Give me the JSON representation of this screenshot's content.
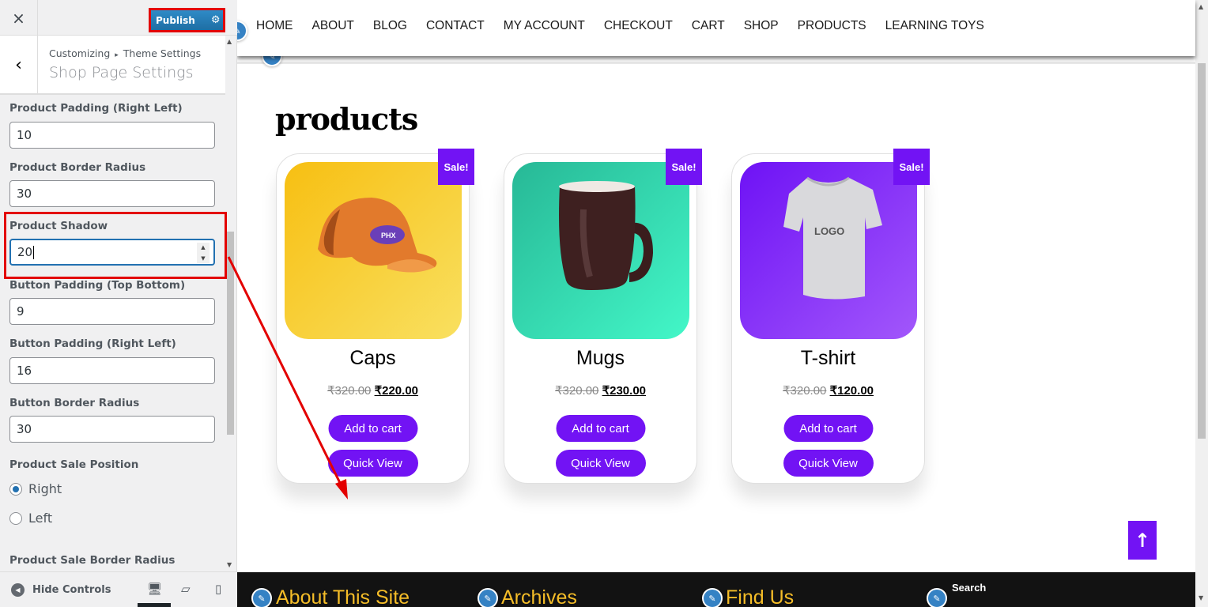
{
  "sidebar": {
    "close_icon": "×",
    "publish_label": "Publish",
    "breadcrumb_root": "Customizing",
    "breadcrumb_separator": "▸",
    "breadcrumb_parent": "Theme Settings",
    "section_title": "Shop Page Settings",
    "controls": [
      {
        "label": "Product Padding (Right Left)",
        "value": "10"
      },
      {
        "label": "Product Border Radius",
        "value": "30"
      },
      {
        "label": "Product Shadow",
        "value": "20"
      },
      {
        "label": "Button Padding (Top Bottom)",
        "value": "9"
      },
      {
        "label": "Button Padding (Right Left)",
        "value": "16"
      },
      {
        "label": "Button Border Radius",
        "value": "30"
      }
    ],
    "sale_position": {
      "label": "Product Sale Position",
      "options": [
        {
          "label": "Right",
          "checked": true
        },
        {
          "label": "Left",
          "checked": false
        }
      ]
    },
    "sale_border_radius_label": "Product Sale Border Radius",
    "footer": {
      "hide_controls_label": "Hide Controls",
      "devices": [
        "desktop",
        "tablet",
        "mobile"
      ],
      "active_device": "desktop"
    }
  },
  "preview": {
    "nav": [
      "HOME",
      "ABOUT",
      "BLOG",
      "CONTACT",
      "MY ACCOUNT",
      "CHECKOUT",
      "CART",
      "SHOP",
      "PRODUCTS",
      "LEARNING TOYS"
    ],
    "page_title": "products",
    "products": [
      {
        "name": "Caps",
        "sale_badge": "Sale!",
        "old_price": "₹320.00",
        "price": "₹220.00",
        "add_to_cart": "Add to cart",
        "quick_view": "Quick View",
        "image": "orange cap"
      },
      {
        "name": "Mugs",
        "sale_badge": "Sale!",
        "old_price": "₹320.00",
        "price": "₹230.00",
        "add_to_cart": "Add to cart",
        "quick_view": "Quick View",
        "image": "brown mug"
      },
      {
        "name": "T-shirt",
        "sale_badge": "Sale!",
        "old_price": "₹320.00",
        "price": "₹120.00",
        "add_to_cart": "Add to cart",
        "quick_view": "Quick View",
        "image": "white t-shirt with LOGO"
      }
    ],
    "tshirt_logo_text": "LOGO",
    "back_to_top_icon": "↑",
    "footer_widgets": [
      "About This Site",
      "Archives",
      "Find Us",
      "Search"
    ]
  },
  "colors": {
    "accent": "#7213f4",
    "publish": "#2271b1",
    "footer_heading": "#f5bd28",
    "annotation": "#e30000"
  }
}
